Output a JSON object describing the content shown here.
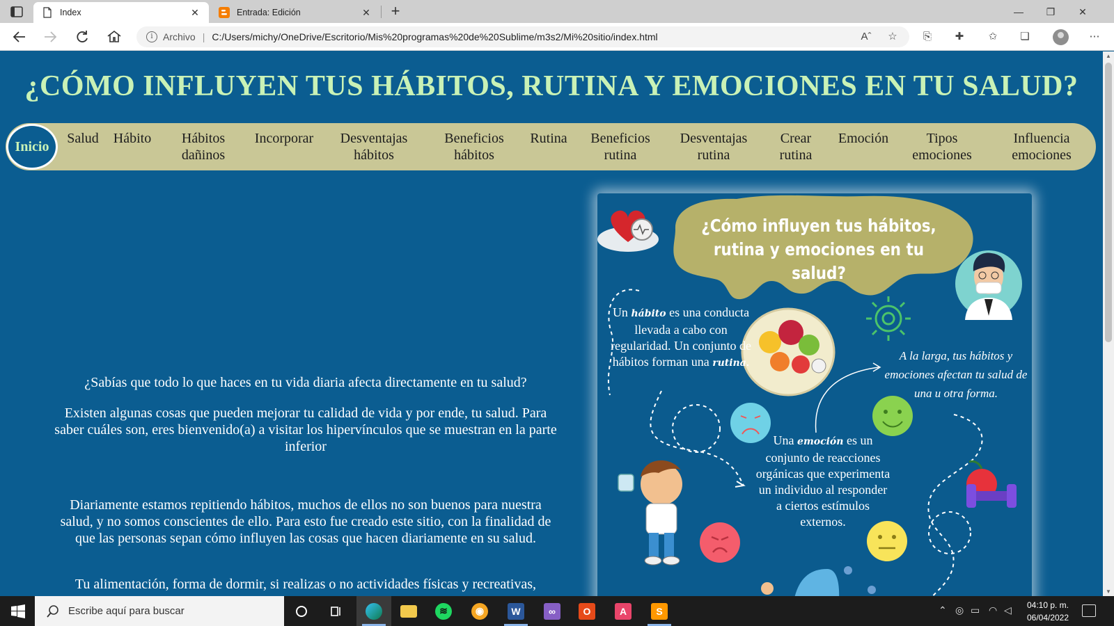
{
  "browser": {
    "tabs": [
      {
        "title": "Index",
        "active": true,
        "icon": "page-icon"
      },
      {
        "title": "Entrada: Edición",
        "active": false,
        "icon": "blogger-icon"
      }
    ],
    "address": {
      "scheme": "Archivo",
      "url": "C:/Users/michy/OneDrive/Escritorio/Mis%20programas%20de%20Sublime/m3s2/Mi%20sitio/index.html"
    }
  },
  "page": {
    "title": "¿CÓMO INFLUYEN TUS HÁBITOS, RUTINA Y EMOCIONES EN TU SALUD?",
    "nav": {
      "home": "Inicio",
      "items": [
        {
          "line1": "Salud",
          "line2": ""
        },
        {
          "line1": "Hábito",
          "line2": ""
        },
        {
          "line1": "Hábitos",
          "line2": "dañinos"
        },
        {
          "line1": "Incorporar",
          "line2": ""
        },
        {
          "line1": "Desventajas",
          "line2": "hábitos"
        },
        {
          "line1": "Beneficios",
          "line2": "hábitos"
        },
        {
          "line1": "Rutina",
          "line2": ""
        },
        {
          "line1": "Beneficios",
          "line2": "rutina"
        },
        {
          "line1": "Desventajas",
          "line2": "rutina"
        },
        {
          "line1": "Crear",
          "line2": "rutina"
        },
        {
          "line1": "Emoción",
          "line2": ""
        },
        {
          "line1": "Tipos",
          "line2": "emociones"
        },
        {
          "line1": "Influencia",
          "line2": "emociones"
        }
      ]
    },
    "intro": {
      "p1": "¿Sabías que todo lo que haces en tu vida diaria afecta directamente en tu salud?",
      "p2": "Existen algunas cosas que pueden mejorar tu calidad de vida y por ende, tu salud. Para saber cuáles son, eres bienvenido(a) a visitar los hipervínculos que se muestran en la parte inferior",
      "p3": "Diariamente estamos repitiendo hábitos, muchos de ellos no son buenos para nuestra salud, y no somos conscientes de ello. Para esto fue creado este sitio, con la finalidad de que las personas sepan cómo influyen las cosas que hacen diariamente en su salud.",
      "p4": "Tu alimentación, forma de dormir, si realizas o no actividades físicas y recreativas,"
    },
    "infographic": {
      "title": "¿Cómo influyen tus hábitos, rutina y emociones en tu salud?",
      "habit": {
        "t1": "Un ",
        "e1": "hábito",
        "t2": " es una conducta llevada a cabo con regularidad. Un conjunto de hábitos forman una ",
        "e2": "rutina",
        "t3": "."
      },
      "long_term": "A la larga, tus hábitos y emociones afectan tu salud de una u otra forma.",
      "emotion": {
        "t1": "Una ",
        "e1": "emoción",
        "t2": " es un conjunto de reacciones orgánicas que experimenta un individuo al responder a ciertos estímulos externos."
      }
    }
  },
  "taskbar": {
    "search_placeholder": "Escribe aquí para buscar",
    "time": "04:10 p. m.",
    "date": "06/04/2022"
  },
  "colors": {
    "page_bg": "#0b5d91",
    "title": "#c9f2b6",
    "nav_bg": "#c9c796"
  }
}
